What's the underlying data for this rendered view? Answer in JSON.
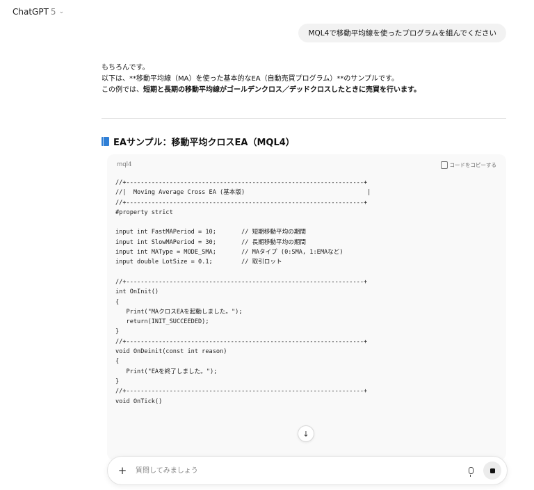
{
  "header": {
    "model_name": "ChatGPT",
    "model_version": "5",
    "chevron_icon": "chevron-down-icon"
  },
  "user_message": "MQL4で移動平均線を使ったプログラムを組んでください",
  "answer": {
    "line1": "もちろんです。",
    "line2": "以下は、**移動平均線（MA）を使った基本的なEA（自動売買プログラム）**のサンプルです。",
    "line3_prefix": "この例では、",
    "line3_bold": "短期と長期の移動平均線がゴールデンクロス／デッドクロスしたときに売買を行います。"
  },
  "section_title": "EAサンプル：移動平均クロスEA（MQL4）",
  "code_block": {
    "language": "mql4",
    "copy_label": "コードをコピーする",
    "lines": [
      "//+------------------------------------------------------------------+",
      "//|  Moving Average Cross EA (基本版)                                  |",
      "//+------------------------------------------------------------------+",
      "#property strict",
      "",
      "input int FastMAPeriod = 10;       // 短期移動平均の期間",
      "input int SlowMAPeriod = 30;       // 長期移動平均の期間",
      "input int MAType = MODE_SMA;       // MAタイプ (0:SMA, 1:EMAなど)",
      "input double LotSize = 0.1;        // 取引ロット",
      "",
      "//+------------------------------------------------------------------+",
      "int OnInit()",
      "{",
      "   Print(\"MAクロスEAを起動しました。\");",
      "   return(INIT_SUCCEEDED);",
      "}",
      "//+------------------------------------------------------------------+",
      "void OnDeinit(const int reason)",
      "{",
      "   Print(\"EAを終了しました。\");",
      "}",
      "//+------------------------------------------------------------------+",
      "void OnTick()"
    ]
  },
  "composer": {
    "placeholder": "質問してみましょう",
    "plus_label": "+",
    "scroll_arrow": "↓"
  }
}
